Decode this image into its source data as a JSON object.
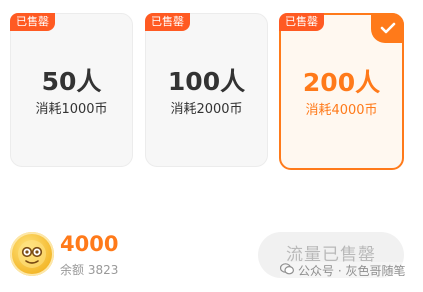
{
  "cards": [
    {
      "badge": "已售罄",
      "title": "50人",
      "subtitle": "消耗1000币",
      "selected": false
    },
    {
      "badge": "已售罄",
      "title": "100人",
      "subtitle": "消耗2000币",
      "selected": false
    },
    {
      "badge": "已售罄",
      "title": "200人",
      "subtitle": "消耗4000币",
      "selected": true
    }
  ],
  "wallet": {
    "amount": "4000",
    "balance_label": "余额",
    "balance_value": "3823"
  },
  "action": {
    "label": "流量已售罄"
  },
  "watermark": {
    "text": "公众号 · 灰色哥随笔",
    "icon": "wechat-icon"
  },
  "colors": {
    "accent": "#ff7a1a",
    "badge": "#ff5a22"
  }
}
